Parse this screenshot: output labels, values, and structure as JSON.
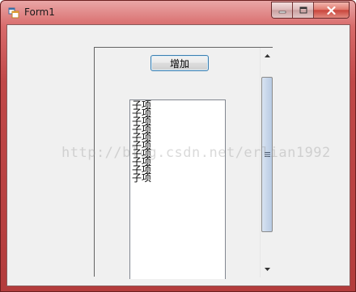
{
  "window": {
    "title": "Form1",
    "icon": "form-app-icon",
    "controls": [
      "minimize-icon",
      "maximize-icon",
      "close-icon"
    ]
  },
  "panel": {
    "add_button_label": "增加",
    "list_items": [
      "子项",
      "子项",
      "子项",
      "子项",
      "子项",
      "子项",
      "子项",
      "子项",
      "子项",
      "子项"
    ]
  },
  "watermark": "http://blog.csdn.net/erlian1992",
  "colors": {
    "title_bar": "#c04848",
    "client_bg": "#f0f0f0",
    "button_border": "#3c7fb1",
    "scroll_thumb": "#c7d6ea"
  }
}
